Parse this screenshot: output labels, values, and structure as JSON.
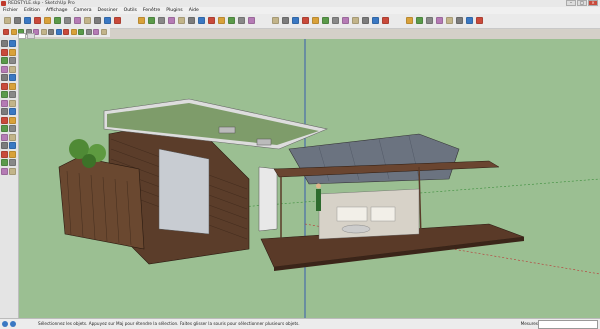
{
  "window": {
    "title": "REDSTYLE.skp - SketchUp Pro"
  },
  "menu": [
    "Fichier",
    "Edition",
    "Affichage",
    "Camera",
    "Dessiner",
    "Outils",
    "Fenêtre",
    "Plugins",
    "Aide"
  ],
  "toolbar": {
    "icons": [
      "select-icon",
      "eraser-icon",
      "paint-icon",
      "line-icon",
      "arc-icon",
      "shape-icon",
      "pushpull-icon",
      "offset-icon",
      "move-icon",
      "rotate-icon",
      "scale-icon",
      "followme-icon",
      "tape-icon",
      "dimension-icon",
      "protractor-icon",
      "text-icon",
      "axes-icon",
      "section-icon",
      "orbit-icon",
      "pan-icon",
      "zoom-icon",
      "zoom-window-icon",
      "zoom-extents-icon",
      "previous-icon",
      "iso-view-icon",
      "top-view-icon",
      "front-view-icon",
      "right-view-icon",
      "back-view-icon",
      "left-view-icon",
      "xray-icon",
      "wireframe-icon",
      "hidden-line-icon",
      "shaded-icon",
      "textured-icon",
      "monochrome-icon",
      "shadow-icon",
      "fog-icon",
      "sandbox-icon",
      "component-icon",
      "warehouse-icon",
      "extension-icon",
      "layer-icon",
      "styles-icon"
    ],
    "colors": [
      "#c2b48a",
      "#7c7c7c",
      "#3a78c3",
      "#c94a3b",
      "#d9a13a",
      "#5a9a4a",
      "#888888",
      "#b57bb5"
    ]
  },
  "toolbar2": {
    "icons": [
      "undo-icon",
      "redo-icon",
      "cut-icon",
      "copy-icon",
      "paste-icon",
      "delete-icon",
      "print-icon",
      "model-info-icon",
      "camera-icon",
      "walk-icon",
      "lookaround-icon",
      "position-icon",
      "sun-icon",
      "time-icon"
    ]
  },
  "tabs": [
    "",
    ""
  ],
  "left_tools": [
    "select-icon",
    "component-icon",
    "paint-icon",
    "eraser-icon",
    "rectangle-icon",
    "line-icon",
    "circle-icon",
    "arc-icon",
    "polygon-icon",
    "freehand-icon",
    "move-icon",
    "pushpull-icon",
    "rotate-icon",
    "followme-icon",
    "scale-icon",
    "offset-icon",
    "tape-icon",
    "dimension-icon",
    "protractor-icon",
    "text-icon",
    "axes-icon",
    "3dtext-icon",
    "orbit-icon",
    "pan-icon",
    "zoom-icon",
    "zoom-window-icon",
    "zoom-extents-icon",
    "previous-icon",
    "position-camera-icon",
    "walk-icon",
    "lookaround-icon",
    "section-icon"
  ],
  "status": {
    "hint": "Sélectionnez les objets. Appuyez sur Maj pour étendre la sélection. Faites glisser la souris pour sélectionner plusieurs objets.",
    "measurements_label": "Mesures",
    "measurements_value": ""
  }
}
